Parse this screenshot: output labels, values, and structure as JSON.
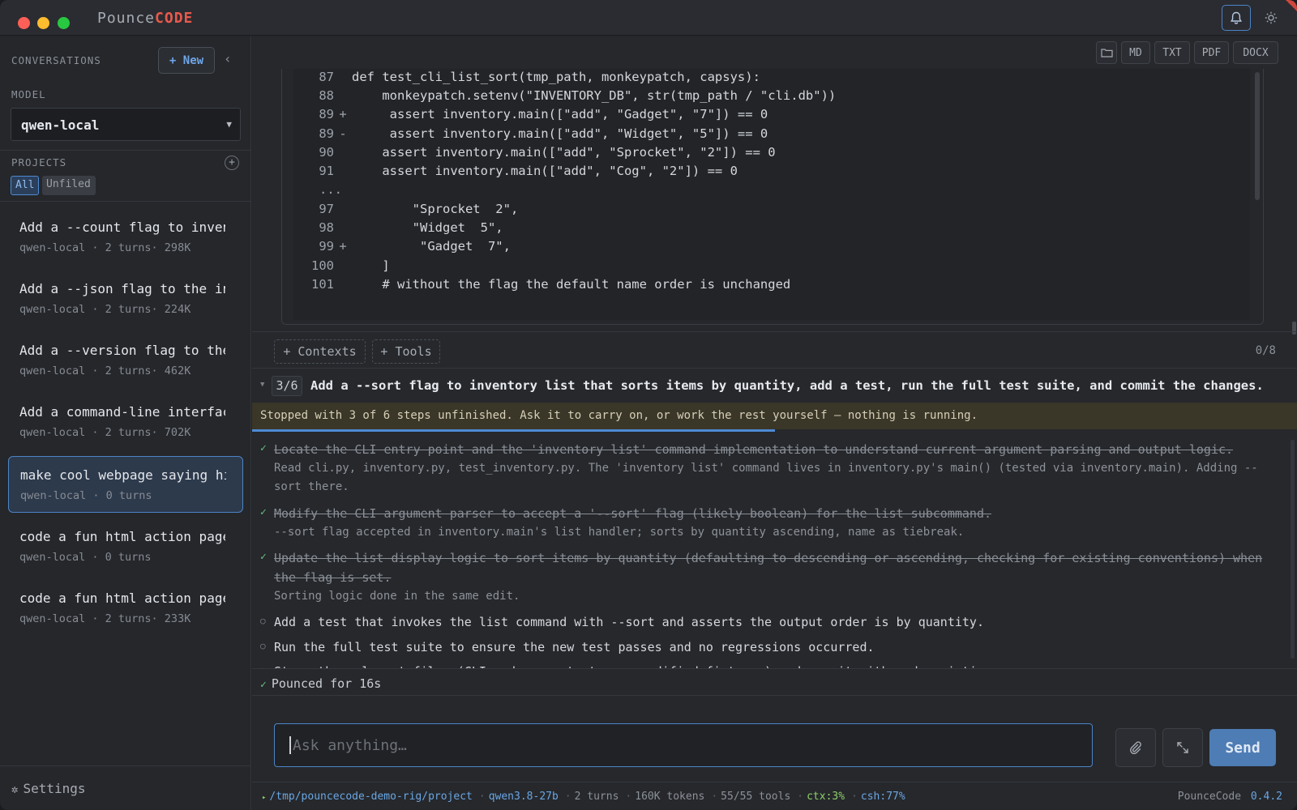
{
  "app": {
    "brand_part1": "Pounce",
    "brand_part2": "CODE"
  },
  "sidebar": {
    "conversations_label": "CONVERSATIONS",
    "new_label": "+ New",
    "collapse_glyph": "‹",
    "model_label": "MODEL",
    "model_value": "qwen-local",
    "projects_label": "PROJECTS",
    "filters": [
      "All",
      "Unfiled"
    ],
    "conversations": [
      {
        "title": "Add a --count flag to inventory",
        "meta": "qwen-local · 2 turns· 298K"
      },
      {
        "title": "Add a --json flag to the inventory",
        "meta": "qwen-local · 2 turns· 224K"
      },
      {
        "title": "Add a --version flag to the cli",
        "meta": "qwen-local · 2 turns· 462K"
      },
      {
        "title": "Add a command-line interface",
        "meta": "qwen-local · 2 turns· 702K"
      },
      {
        "title": "make cool webpage saying hi",
        "meta": "qwen-local · 0 turns",
        "active": true
      },
      {
        "title": "code a fun html action page",
        "meta": "qwen-local · 0 turns"
      },
      {
        "title": "code a fun html action page",
        "meta": "qwen-local · 2 turns· 233K"
      }
    ],
    "settings_label": "Settings"
  },
  "export_buttons": [
    "MD",
    "TXT",
    "PDF",
    "DOCX"
  ],
  "code_lines": [
    {
      "ln": "87",
      "mk": "",
      "text": "def test_cli_list_sort(tmp_path, monkeypatch, capsys):"
    },
    {
      "ln": "88",
      "mk": "",
      "text": "    monkeypatch.setenv(\"INVENTORY_DB\", str(tmp_path / \"cli.db\"))"
    },
    {
      "ln": "89",
      "mk": "+",
      "text": "     assert inventory.main([\"add\", \"Gadget\", \"7\"]) == 0"
    },
    {
      "ln": "89",
      "mk": "-",
      "text": "     assert inventory.main([\"add\", \"Widget\", \"5\"]) == 0"
    },
    {
      "ln": "90",
      "mk": "",
      "text": "    assert inventory.main([\"add\", \"Sprocket\", \"2\"]) == 0"
    },
    {
      "ln": "91",
      "mk": "",
      "text": "    assert inventory.main([\"add\", \"Cog\", \"2\"]) == 0"
    },
    {
      "ln": "...",
      "mk": "",
      "text": ""
    },
    {
      "ln": "97",
      "mk": "",
      "text": "        \"Sprocket  2\","
    },
    {
      "ln": "98",
      "mk": "",
      "text": "        \"Widget  5\","
    },
    {
      "ln": "99",
      "mk": "+",
      "text": "         \"Gadget  7\","
    },
    {
      "ln": "100",
      "mk": "",
      "text": "    ]"
    },
    {
      "ln": "101",
      "mk": "",
      "text": "    # without the flag the default name order is unchanged"
    }
  ],
  "toolbar": {
    "contexts_label": "+ Contexts",
    "tools_label": "+ Tools",
    "count": "0/8"
  },
  "plan": {
    "step": "3/6",
    "title": "Add a --sort flag to inventory list that sorts items by quantity, add a test, run the full test suite, and commit the changes.",
    "stopped_message": "Stopped with 3 of 6 steps unfinished. Ask it to carry on, or work the rest yourself — nothing is running.",
    "progress": 0.5,
    "steps": [
      {
        "done": true,
        "text": "Locate the CLI entry point and the 'inventory list' command implementation to understand current argument parsing and output logic.",
        "note": "Read cli.py, inventory.py, test_inventory.py. The 'inventory list' command lives in inventory.py's main() (tested via inventory.main). Adding --sort there."
      },
      {
        "done": true,
        "text": "Modify the CLI argument parser to accept a '--sort' flag (likely boolean) for the list subcommand.",
        "note": "--sort flag accepted in inventory.main's list handler; sorts by quantity ascending, name as tiebreak."
      },
      {
        "done": true,
        "text": "Update the list display logic to sort items by quantity (defaulting to descending or ascending, checking for existing conventions) when the flag is set.",
        "note": "Sorting logic done in the same edit."
      },
      {
        "done": false,
        "text": "Add a test that invokes the list command with --sort and asserts the output order is by quantity.",
        "note": ""
      },
      {
        "done": false,
        "text": "Run the full test suite to ensure the new test passes and no regressions occurred.",
        "note": ""
      },
      {
        "done": false,
        "text": "Stage the relevant files (CLI code, new test, any modified fixtures) and commit with a descriptive message.",
        "note": ""
      }
    ]
  },
  "pounced_label": "Pounced for 16s",
  "composer": {
    "placeholder": "Ask anything…",
    "send_label": "Send"
  },
  "status": {
    "path": "/tmp/pouncecode-demo-rig/project",
    "model": "qwen3.8-27b",
    "turns": "2 turns",
    "tokens": "160K tokens",
    "tools": "55/55 tools",
    "ctx": "ctx:3%",
    "csh": "csh:77%",
    "app_name": "PounceCode",
    "version": "0.4.2"
  },
  "icons": {
    "bell": "bell-icon",
    "theme": "sun-icon",
    "folder": "folder-icon",
    "attach": "paperclip-icon",
    "expand": "expand-icon",
    "settings": "gear-icon"
  }
}
